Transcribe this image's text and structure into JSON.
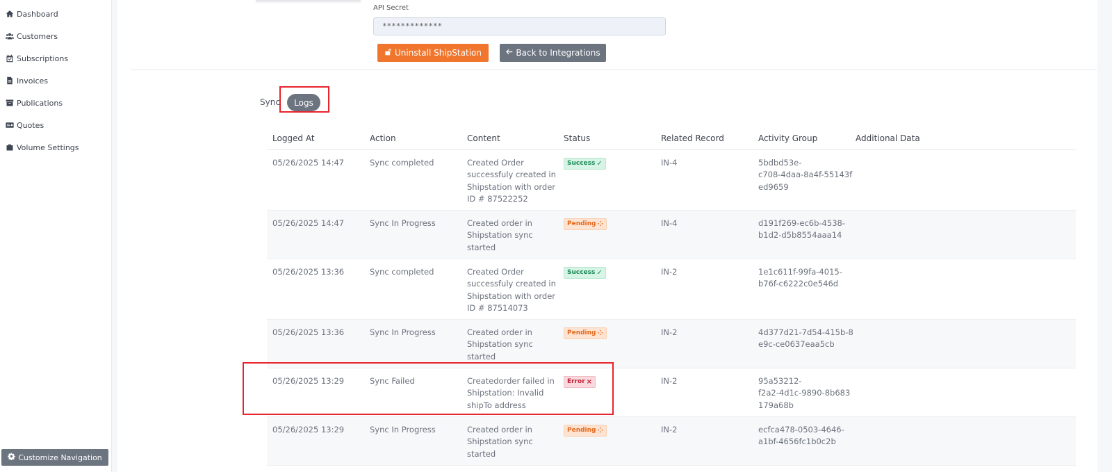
{
  "sidebar": {
    "items": [
      {
        "label": "Dashboard",
        "icon": "home-icon"
      },
      {
        "label": "Customers",
        "icon": "users-icon"
      },
      {
        "label": "Subscriptions",
        "icon": "calendar-check-icon"
      },
      {
        "label": "Invoices",
        "icon": "file-invoice-icon"
      },
      {
        "label": "Publications",
        "icon": "archive-icon"
      },
      {
        "label": "Quotes",
        "icon": "quote-card-icon"
      },
      {
        "label": "Volume Settings",
        "icon": "briefcase-icon"
      }
    ],
    "customize_label": "Customize Navigation"
  },
  "integration": {
    "api_secret_label": "API Secret",
    "api_secret_value": "*************",
    "uninstall_label": "Uninstall ShipStation",
    "back_label": "Back to Integrations"
  },
  "tabs": {
    "sync_label": "Sync",
    "logs_label": "Logs"
  },
  "table": {
    "headers": [
      "Logged At",
      "Action",
      "Content",
      "Status",
      "Related Record",
      "Activity Group",
      "Additional Data"
    ],
    "rows": [
      {
        "logged_at": "05/26/2025 14:47",
        "action": "Sync completed",
        "content": "Created Order\nsuccessfuly created in\nShipstation with order\nID # 87522252",
        "status": "Success",
        "status_icon": "✓",
        "related": "IN-4",
        "group": "5bdbd53e-\nc708-4daa-8a4f-55143f\ned9659",
        "additional": ""
      },
      {
        "logged_at": "05/26/2025 14:47",
        "action": "Sync In Progress",
        "content": "Created order in\nShipstation sync\nstarted",
        "status": "Pending",
        "status_icon": "⁘",
        "related": "IN-4",
        "group": "d191f269-ec6b-4538-\nb1d2-d5b8554aaa14",
        "additional": ""
      },
      {
        "logged_at": "05/26/2025 13:36",
        "action": "Sync completed",
        "content": "Created Order\nsuccessfuly created in\nShipstation with order\nID # 87514073",
        "status": "Success",
        "status_icon": "✓",
        "related": "IN-2",
        "group": "1e1c611f-99fa-4015-\nb76f-c6222c0e546d",
        "additional": ""
      },
      {
        "logged_at": "05/26/2025 13:36",
        "action": "Sync In Progress",
        "content": "Created order in\nShipstation sync\nstarted",
        "status": "Pending",
        "status_icon": "⁘",
        "related": "IN-2",
        "group": "4d377d21-7d54-415b-8\ne9c-ce0637eaa5cb",
        "additional": ""
      },
      {
        "logged_at": "05/26/2025 13:29",
        "action": "Sync Failed",
        "content": "Createdorder failed in\nShipstation: Invalid\nshipTo address",
        "status": "Error",
        "status_icon": "×",
        "related": "IN-2",
        "group": "95a53212-\nf2a2-4d1c-9890-8b683\n179a68b",
        "additional": ""
      },
      {
        "logged_at": "05/26/2025 13:29",
        "action": "Sync In Progress",
        "content": "Created order in\nShipstation sync\nstarted",
        "status": "Pending",
        "status_icon": "⁘",
        "related": "IN-2",
        "group": "ecfca478-0503-4646-\na1bf-4656fc1b0c2b",
        "additional": ""
      }
    ]
  },
  "colors": {
    "accent_orange": "#f0762e",
    "button_gray": "#6c7480",
    "highlight_red": "#e8232a"
  }
}
